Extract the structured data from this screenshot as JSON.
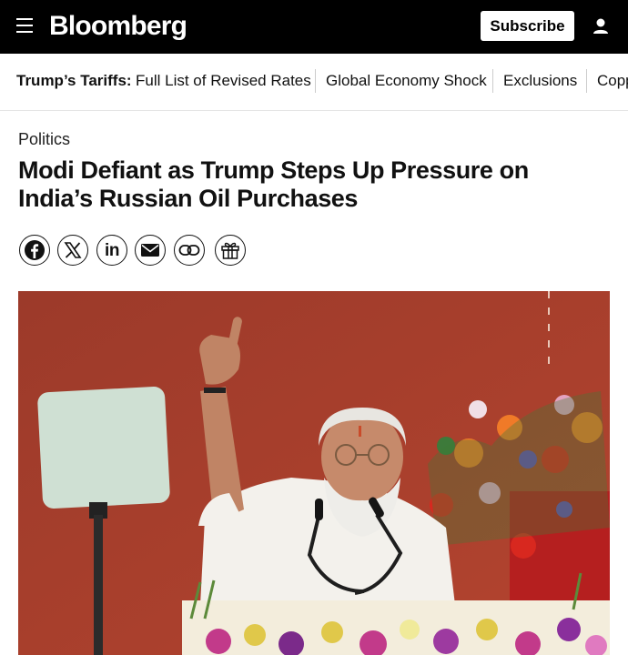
{
  "header": {
    "brand": "Bloomberg",
    "subscribe_label": "Subscribe",
    "icons": [
      "menu-icon",
      "user-icon"
    ]
  },
  "nav": {
    "label": "Trump’s Tariffs:",
    "items": [
      "Full List of Revised Rates",
      "Global Economy Shock",
      "Exclusions",
      "Copp"
    ]
  },
  "article": {
    "section": "Politics",
    "headline_line1": "Modi Defiant as Trump Steps Up Pressure on",
    "headline_line2": "India’s Russian Oil Purchases"
  },
  "share": {
    "icons": [
      "facebook-icon",
      "x-icon",
      "linkedin-icon",
      "email-icon",
      "link-icon",
      "gift-icon"
    ],
    "linkedin_text": "in"
  },
  "colors": {
    "topbar": "#000000",
    "photo_background": "#a23d2c"
  }
}
